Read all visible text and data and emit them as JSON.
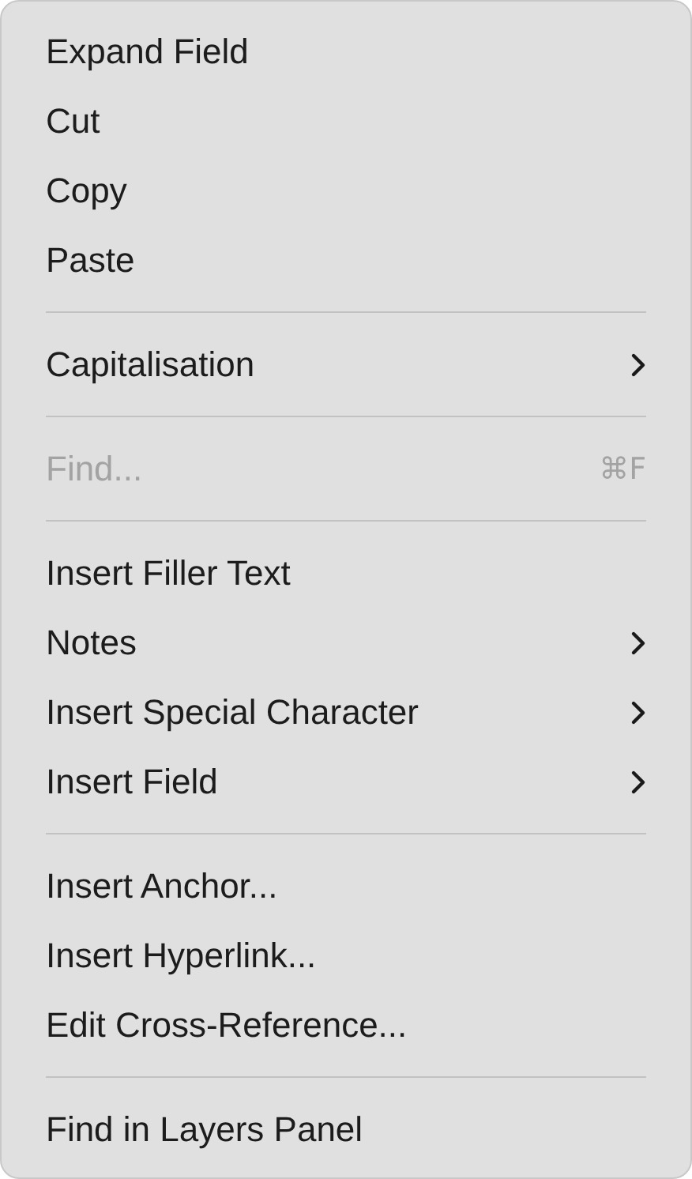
{
  "context_menu": {
    "sections": [
      {
        "items": [
          {
            "label": "Expand Field",
            "disabled": false,
            "submenu": false
          },
          {
            "label": "Cut",
            "disabled": false,
            "submenu": false
          },
          {
            "label": "Copy",
            "disabled": false,
            "submenu": false
          },
          {
            "label": "Paste",
            "disabled": false,
            "submenu": false
          }
        ]
      },
      {
        "items": [
          {
            "label": "Capitalisation",
            "disabled": false,
            "submenu": true
          }
        ]
      },
      {
        "items": [
          {
            "label": "Find...",
            "disabled": true,
            "submenu": false,
            "shortcut": "⌘F"
          }
        ]
      },
      {
        "items": [
          {
            "label": "Insert Filler Text",
            "disabled": false,
            "submenu": false
          },
          {
            "label": "Notes",
            "disabled": false,
            "submenu": true
          },
          {
            "label": "Insert Special Character",
            "disabled": false,
            "submenu": true
          },
          {
            "label": "Insert Field",
            "disabled": false,
            "submenu": true
          }
        ]
      },
      {
        "items": [
          {
            "label": "Insert Anchor...",
            "disabled": false,
            "submenu": false
          },
          {
            "label": "Insert Hyperlink...",
            "disabled": false,
            "submenu": false
          },
          {
            "label": "Edit Cross-Reference...",
            "disabled": false,
            "submenu": false
          }
        ]
      },
      {
        "items": [
          {
            "label": "Find in Layers Panel",
            "disabled": false,
            "submenu": false
          }
        ]
      }
    ]
  }
}
